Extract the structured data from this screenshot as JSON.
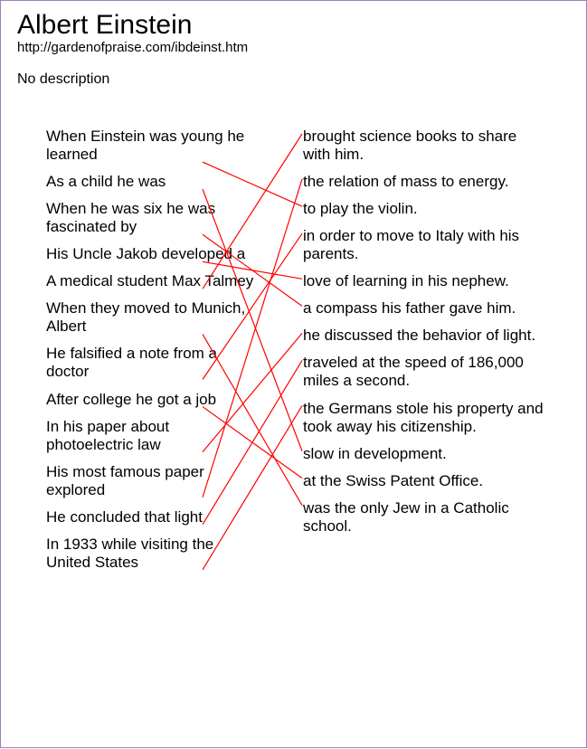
{
  "header": {
    "title": "Albert Einstein",
    "url": "http://gardenofpraise.com/ibdeinst.htm",
    "description": "No description"
  },
  "left_items": [
    "When Einstein was young he learned",
    "As a child he was",
    "When he was six he was fascinated by",
    "His Uncle Jakob developed a",
    "A medical student Max Talmey",
    "When they moved to Munich, Albert",
    "He falsified a note from a doctor",
    "After college he got a job",
    "In his paper about photoelectric law",
    "His most famous paper explored",
    "He concluded that light",
    "In 1933 while visiting the United States"
  ],
  "right_items": [
    "brought science books to share with him.",
    "the relation of mass to energy.",
    "to play the violin.",
    "in order to move to Italy with his parents.",
    "love of learning in his nephew.",
    "a compass his father gave him.",
    "he discussed the behavior of light.",
    "traveled at the speed of 186,000 miles a second.",
    "the Germans stole his property and took away his citizenship.",
    "slow in development.",
    "at the Swiss Patent Office.",
    "was the only Jew in a Catholic school."
  ],
  "connections": [
    [
      0,
      2
    ],
    [
      1,
      9
    ],
    [
      2,
      5
    ],
    [
      3,
      4
    ],
    [
      4,
      0
    ],
    [
      5,
      11
    ],
    [
      6,
      3
    ],
    [
      7,
      10
    ],
    [
      8,
      6
    ],
    [
      9,
      1
    ],
    [
      10,
      7
    ],
    [
      11,
      8
    ]
  ],
  "line_color": "#ff0000"
}
